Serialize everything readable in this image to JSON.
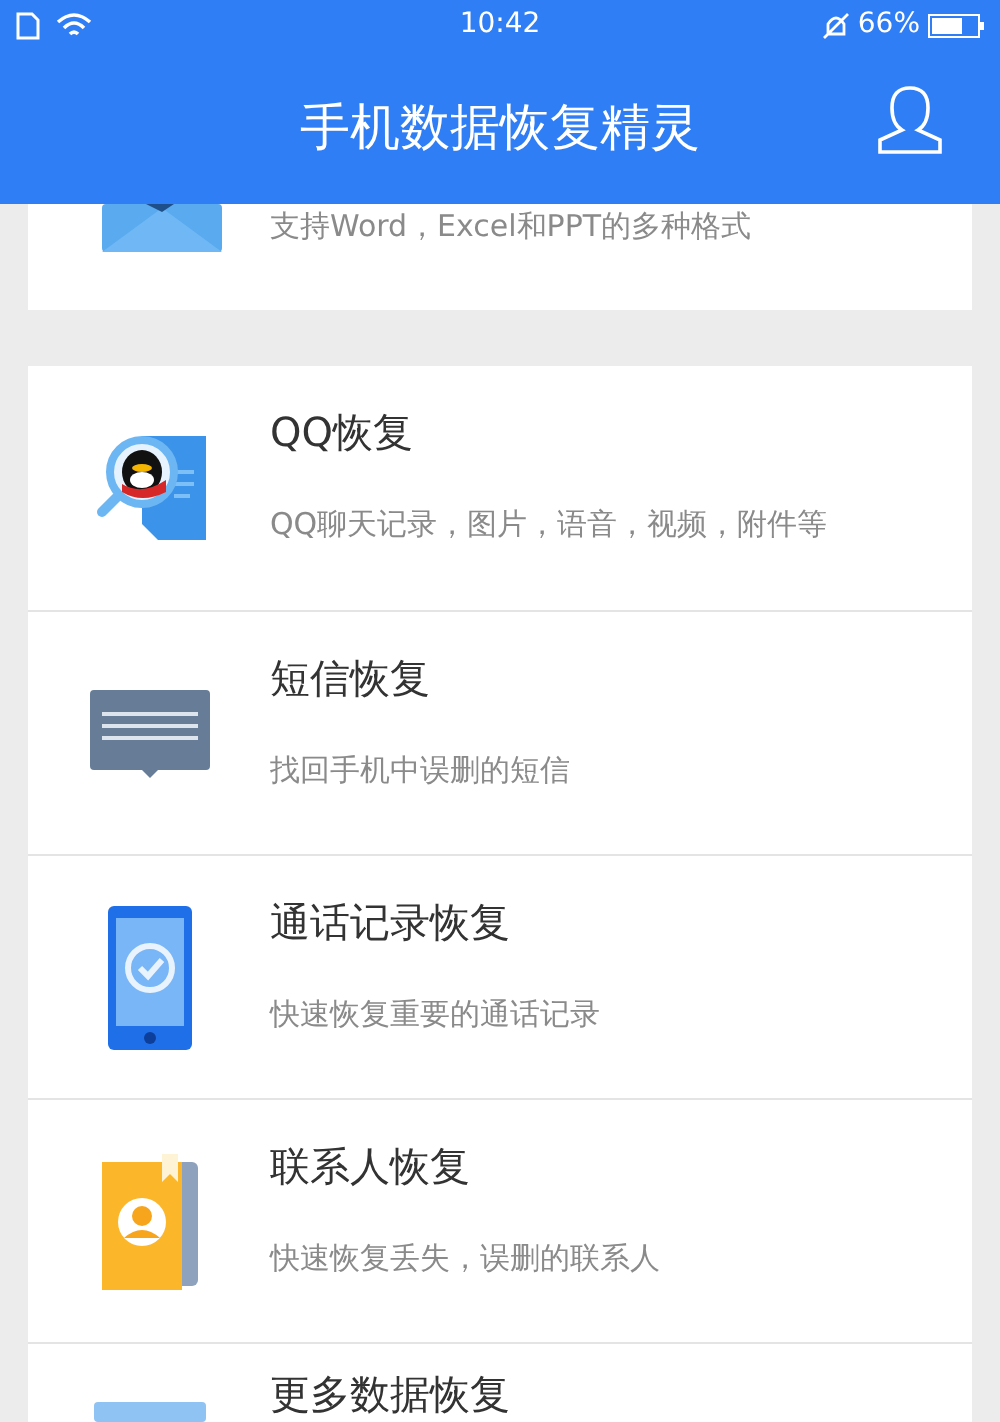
{
  "status_bar": {
    "time": "10:42",
    "battery": "66%"
  },
  "header": {
    "title": "手机数据恢复精灵"
  },
  "partial_card": {
    "subtitle": "支持Word，Excel和PPT的多种格式"
  },
  "items": [
    {
      "title": "QQ恢复",
      "subtitle": "QQ聊天记录，图片，语音，视频，附件等"
    },
    {
      "title": "短信恢复",
      "subtitle": "找回手机中误删的短信"
    },
    {
      "title": "通话记录恢复",
      "subtitle": "快速恢复重要的通话记录"
    },
    {
      "title": "联系人恢复",
      "subtitle": "快速恢复丢失，误删的联系人"
    },
    {
      "title": "更多数据恢复"
    }
  ]
}
